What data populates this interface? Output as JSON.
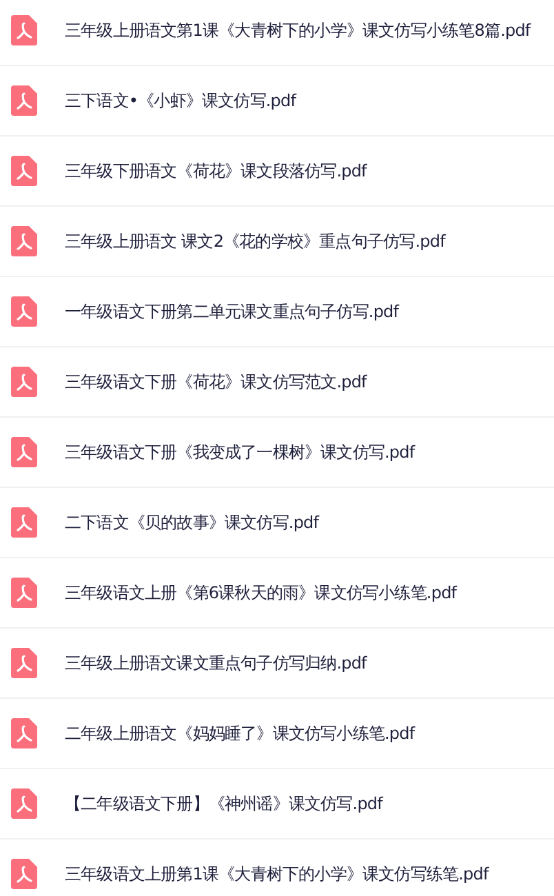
{
  "files": [
    {
      "name": "三年级上册语文第1课《大青树下的小学》课文仿写小练笔8篇.pdf"
    },
    {
      "name": "三下语文•《小虾》课文仿写.pdf"
    },
    {
      "name": "三年级下册语文《荷花》课文段落仿写.pdf"
    },
    {
      "name": "三年级上册语文 课文2《花的学校》重点句子仿写.pdf"
    },
    {
      "name": "一年级语文下册第二单元课文重点句子仿写.pdf"
    },
    {
      "name": "三年级语文下册《荷花》课文仿写范文.pdf"
    },
    {
      "name": "三年级语文下册《我变成了一棵树》课文仿写.pdf"
    },
    {
      "name": "二下语文《贝的故事》课文仿写.pdf"
    },
    {
      "name": "三年级语文上册《第6课秋天的雨》课文仿写小练笔.pdf"
    },
    {
      "name": "三年级上册语文课文重点句子仿写归纳.pdf"
    },
    {
      "name": "二年级上册语文《妈妈睡了》课文仿写小练笔.pdf"
    },
    {
      "name": "【二年级语文下册】《神州谣》课文仿写.pdf"
    },
    {
      "name": "三年级语文上册第1课《大青树下的小学》课文仿写练笔.pdf"
    }
  ]
}
